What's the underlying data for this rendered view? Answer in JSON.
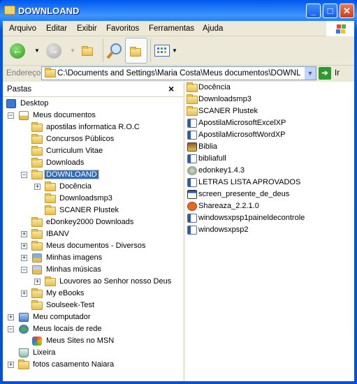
{
  "window": {
    "title": "DOWNLOAND"
  },
  "menu": [
    "Arquivo",
    "Editar",
    "Exibir",
    "Favoritos",
    "Ferramentas",
    "Ajuda"
  ],
  "address": {
    "label": "Endereço",
    "value": "C:\\Documents and Settings\\Maria Costa\\Meus documentos\\DOWNLOAND",
    "go": "Ir"
  },
  "folders_pane": {
    "title": "Pastas",
    "close": "×"
  },
  "tree": [
    {
      "label": "Desktop",
      "level": 0,
      "exp": "",
      "icon": "desktop"
    },
    {
      "label": "Meus documentos",
      "level": 1,
      "exp": "-",
      "icon": "mydocs"
    },
    {
      "label": "apostilas informatica R.O.C",
      "level": 2,
      "exp": "",
      "icon": "folder"
    },
    {
      "label": "Concursos Públicos",
      "level": 2,
      "exp": "",
      "icon": "folder"
    },
    {
      "label": "Curriculum Vitae",
      "level": 2,
      "exp": "",
      "icon": "folder"
    },
    {
      "label": "Downloads",
      "level": 2,
      "exp": "",
      "icon": "folder"
    },
    {
      "label": "DOWNLOAND",
      "level": 2,
      "exp": "-",
      "icon": "folder-open",
      "selected": true
    },
    {
      "label": "Docência",
      "level": 3,
      "exp": "+",
      "icon": "folder"
    },
    {
      "label": "Downloadsmp3",
      "level": 3,
      "exp": "",
      "icon": "folder"
    },
    {
      "label": "SCANER Plustek",
      "level": 3,
      "exp": "",
      "icon": "folder"
    },
    {
      "label": "eDonkey2000 Downloads",
      "level": 2,
      "exp": "",
      "icon": "folder"
    },
    {
      "label": "IBANV",
      "level": 2,
      "exp": "+",
      "icon": "folder"
    },
    {
      "label": "Meus documentos - Diversos",
      "level": 2,
      "exp": "+",
      "icon": "folder"
    },
    {
      "label": "Minhas imagens",
      "level": 2,
      "exp": "+",
      "icon": "mypictures"
    },
    {
      "label": "Minhas músicas",
      "level": 2,
      "exp": "-",
      "icon": "mymusic"
    },
    {
      "label": "Louvores ao Senhor nosso Deus",
      "level": 3,
      "exp": "+",
      "icon": "folder"
    },
    {
      "label": "My eBooks",
      "level": 2,
      "exp": "+",
      "icon": "folder"
    },
    {
      "label": "Soulseek-Test",
      "level": 2,
      "exp": "",
      "icon": "folder"
    },
    {
      "label": "Meu computador",
      "level": 1,
      "exp": "+",
      "icon": "computer"
    },
    {
      "label": "Meus locais de rede",
      "level": 1,
      "exp": "-",
      "icon": "network"
    },
    {
      "label": "Meus Sites no MSN",
      "level": 2,
      "exp": "",
      "icon": "msn"
    },
    {
      "label": "Lixeira",
      "level": 1,
      "exp": "",
      "icon": "recycle-bin"
    },
    {
      "label": "fotos casamento Naiara",
      "level": 1,
      "exp": "+",
      "icon": "folder"
    }
  ],
  "files": [
    {
      "label": "Docência",
      "icon": "folder"
    },
    {
      "label": "Downloadsmp3",
      "icon": "folder"
    },
    {
      "label": "SCANER Plustek",
      "icon": "folder"
    },
    {
      "label": "ApostilaMicrosoftExcelXP",
      "icon": "word-doc"
    },
    {
      "label": "ApostilaMicrosoftWordXP",
      "icon": "word-doc"
    },
    {
      "label": "Biblia",
      "icon": "program"
    },
    {
      "label": "bibliafull",
      "icon": "word-doc"
    },
    {
      "label": "edonkey1.4.3",
      "icon": "edonkey"
    },
    {
      "label": "LETRAS LISTA APROVADOS",
      "icon": "word-doc"
    },
    {
      "label": "screen_presente_de_deus",
      "icon": "window-file"
    },
    {
      "label": "Shareaza_2.2.1.0",
      "icon": "shareaza"
    },
    {
      "label": "windowsxpsp1paineldecontrole",
      "icon": "word-doc"
    },
    {
      "label": "windowsxpsp2",
      "icon": "word-doc"
    }
  ]
}
